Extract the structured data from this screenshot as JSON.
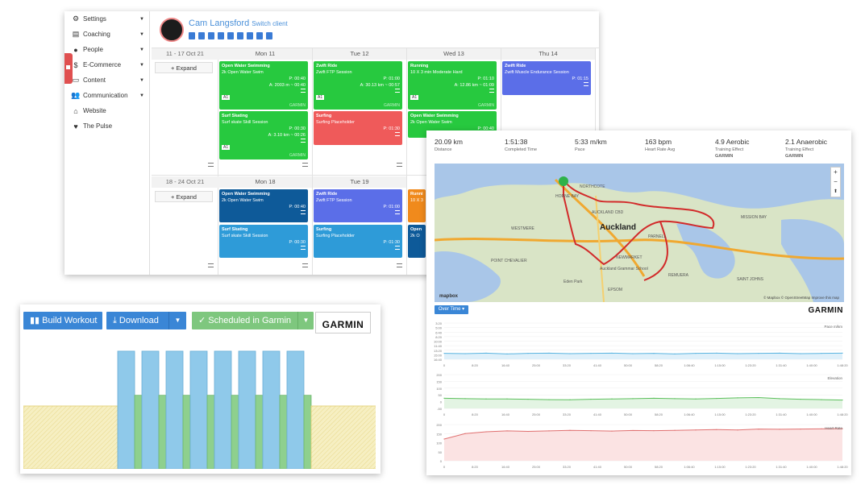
{
  "calendar": {
    "nav": [
      {
        "label": "Settings",
        "icon": "gears-icon"
      },
      {
        "label": "Coaching",
        "icon": "coaching-icon"
      },
      {
        "label": "People",
        "icon": "user-icon"
      },
      {
        "label": "E-Commerce",
        "icon": "dollar-icon"
      },
      {
        "label": "Content",
        "icon": "content-icon"
      },
      {
        "label": "Communication",
        "icon": "users-icon"
      },
      {
        "label": "Website",
        "icon": "home-icon"
      },
      {
        "label": "The Pulse",
        "icon": "heartbeat-icon"
      }
    ],
    "client_name": "Cam Langsford",
    "switch_label": "Switch client",
    "expand_label": "+ Expand",
    "week1": {
      "label": "11 - 17 Oct 21",
      "days": [
        "Mon 11",
        "Tue 12",
        "Wed 13",
        "Thu 14"
      ]
    },
    "week2": {
      "label": "18 - 24 Oct 21",
      "days": [
        "Mon 18",
        "Tue 19"
      ]
    },
    "workouts": [
      {
        "title": "Open Water Swimming",
        "sub": "2k Open Water Swim",
        "planned": "P: 00:40",
        "actual": "A: 2003 m ~ 00:40",
        "tag": "A1",
        "garmin": "GARMIN",
        "color": "#27c93f"
      },
      {
        "title": "Zwift Ride",
        "sub": "Zwift FTP Session",
        "planned": "P: 01:00",
        "actual": "A: 30.13 km ~ 00:57",
        "tag": "A1",
        "garmin": "GARMIN",
        "color": "#27c93f"
      },
      {
        "title": "Running",
        "sub": "10 X 3 min Moderate Hard",
        "planned": "P: 01:10",
        "actual": "A: 12.86 km ~ 01:09",
        "tag": "A1",
        "garmin": "GARMIN",
        "color": "#27c93f"
      },
      {
        "title": "Zwift Ride",
        "sub": "Zwift Muscle Endurance Session",
        "planned": "P: 01:15",
        "color": "#5b6ee8"
      },
      {
        "title": "Surf Skating",
        "sub": "Surf skate Skill Session",
        "planned": "P: 00:30",
        "actual": "A: 3.10 km ~ 00:26",
        "tag": "A1",
        "garmin": "GARMIN",
        "color": "#27c93f"
      },
      {
        "title": "Surfing",
        "sub": "Surfing Placeholder",
        "planned": "P: 01:30",
        "color": "#ef5a5a"
      },
      {
        "title": "Open Water Swimming",
        "sub": "2k Open Water Swim",
        "planned": "P: 00:40",
        "color": "#27c93f"
      },
      {
        "title": "Open Water Swimming",
        "sub": "2k Open Water Swim",
        "planned": "P: 00:40",
        "color": "#0e5a99"
      },
      {
        "title": "Zwift Ride",
        "sub": "Zwift FTP Session",
        "planned": "P: 01:00",
        "color": "#5b6ee8"
      },
      {
        "title": "Runni",
        "sub": "10 X 3",
        "color": "#f08a1c"
      },
      {
        "title": "Surf Skating",
        "sub": "Surf skate Skill Session",
        "planned": "P: 00:30",
        "color": "#2e9bd8"
      },
      {
        "title": "Surfing",
        "sub": "Surfing Placeholder",
        "planned": "P: 01:30",
        "color": "#2e9bd8"
      },
      {
        "title": "Open",
        "sub": "2k O",
        "color": "#0e5a99"
      }
    ]
  },
  "activity": {
    "stats": [
      {
        "value": "20.09 km",
        "label": "Distance"
      },
      {
        "value": "1:51:38",
        "label": "Completed Time"
      },
      {
        "value": "5:33 m/km",
        "label": "Pace"
      },
      {
        "value": "163 bpm",
        "label": "Heart Rate Avg"
      },
      {
        "value": "4.9 Aerobic",
        "label": "Training Effect"
      },
      {
        "value": "2.1 Anaerobic",
        "label": "Training Effect"
      }
    ],
    "garmin_small": "GARMIN",
    "map": {
      "city": "Auckland",
      "places": [
        "NORTHCOTE",
        "HORNE BAY",
        "AUCKLAND CBD",
        "WESTMERE",
        "PARNELL",
        "NEWMARKET",
        "Eden Park",
        "Auckland Grammar School",
        "MISSION BAY",
        "POINT CHEVALIER",
        "EPSOM",
        "REMUERA",
        "SAINT JOHNS"
      ],
      "zoom_in": "+",
      "zoom_out": "−",
      "compass": "⬆",
      "logo": "mapbox",
      "attribution": "© Mapbox © OpenStreetMap Improve this map"
    },
    "over_time_label": "Over Time ▾",
    "garmin": "GARMIN",
    "x_ticks": [
      "0",
      "8:20",
      "16:40",
      "25:00",
      "33:20",
      "41:40",
      "50:00",
      "58:20",
      "1:06:40",
      "1:15:00",
      "1:23:20",
      "1:31:40",
      "1:40:00",
      "1:48:20"
    ]
  },
  "chart_data": [
    {
      "type": "line",
      "title": "",
      "series": [
        {
          "name": "Pace m/km",
          "values": [
            5.5,
            5.4,
            5.6,
            5.3,
            5.5,
            5.6,
            5.4,
            5.5,
            5.6,
            5.4,
            5.5,
            5.3,
            5.5,
            5.6,
            5.4,
            5.5,
            5.6,
            5.4,
            5.5,
            5.6
          ]
        }
      ],
      "y_ticks": [
        "3:20",
        "5:00",
        "6:40",
        "8:20",
        "10:00",
        "11:40",
        "13:20",
        "15:00",
        "16:40"
      ],
      "ylim": [
        3.33,
        16.67
      ]
    },
    {
      "type": "line",
      "title": "",
      "series": [
        {
          "name": "Elevation",
          "values": [
            25,
            22,
            20,
            20,
            18,
            15,
            14,
            18,
            20,
            22,
            25,
            22,
            20,
            24,
            28,
            30,
            22,
            18,
            15,
            12
          ]
        }
      ],
      "y_ticks": [
        "200",
        "150",
        "100",
        "50",
        "0",
        "-50"
      ],
      "ylim": [
        -50,
        200
      ]
    },
    {
      "type": "line",
      "title": "",
      "series": [
        {
          "name": "Heart Rate",
          "values": [
            120,
            150,
            160,
            165,
            162,
            165,
            168,
            166,
            164,
            167,
            166,
            168,
            170,
            172,
            170,
            175,
            174,
            175,
            176,
            177
          ]
        }
      ],
      "y_ticks": [
        "200",
        "150",
        "100",
        "50",
        "0"
      ],
      "ylim": [
        0,
        200
      ]
    }
  ],
  "builder": {
    "build_label": "Build Workout",
    "download_label": "Download",
    "scheduled_label": "Scheduled in Garmin",
    "garmin": "GARMIN",
    "intervals": [
      {
        "kind": "warmup",
        "level": 0.47
      },
      {
        "kind": "work",
        "level": 0.88
      },
      {
        "kind": "rest",
        "level": 0.55
      },
      {
        "kind": "work",
        "level": 0.88
      },
      {
        "kind": "rest",
        "level": 0.55
      },
      {
        "kind": "work",
        "level": 0.88
      },
      {
        "kind": "rest",
        "level": 0.55
      },
      {
        "kind": "work",
        "level": 0.88
      },
      {
        "kind": "rest",
        "level": 0.55
      },
      {
        "kind": "work",
        "level": 0.88
      },
      {
        "kind": "rest",
        "level": 0.55
      },
      {
        "kind": "work",
        "level": 0.88
      },
      {
        "kind": "rest",
        "level": 0.55
      },
      {
        "kind": "work",
        "level": 0.88
      },
      {
        "kind": "rest",
        "level": 0.55
      },
      {
        "kind": "work",
        "level": 0.88
      },
      {
        "kind": "rest",
        "level": 0.55
      },
      {
        "kind": "cooldown",
        "level": 0.47
      }
    ]
  }
}
